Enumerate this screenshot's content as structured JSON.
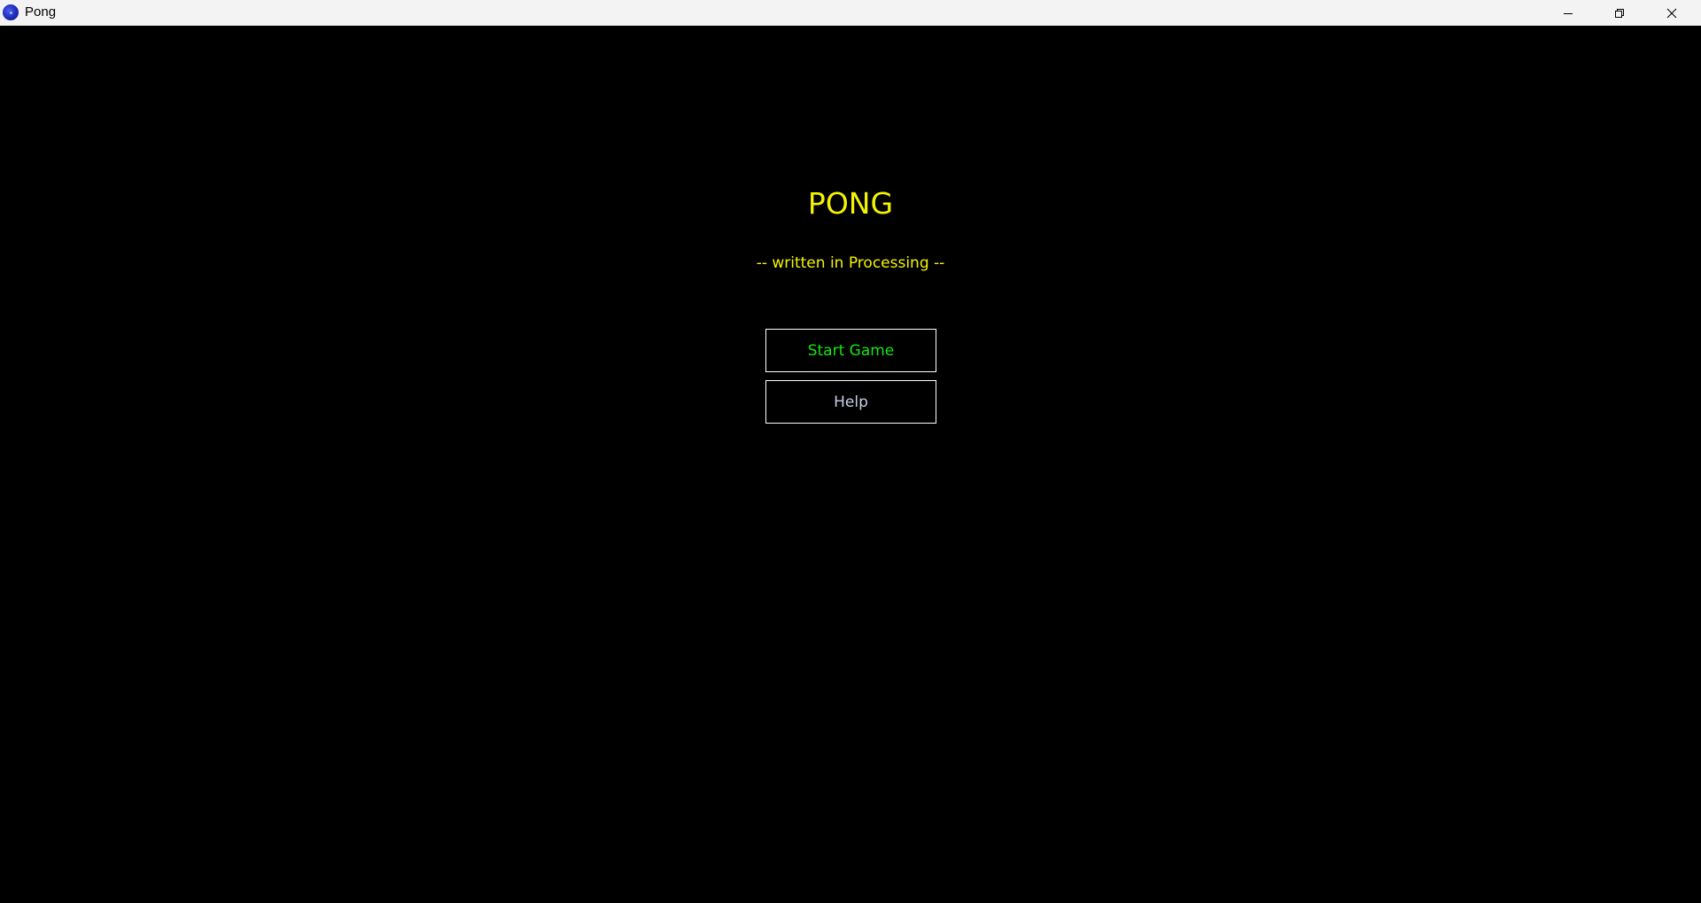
{
  "window": {
    "title": "Pong",
    "icon": "pong-app-icon",
    "controls": {
      "minimize_icon": "minimize-icon",
      "maximize_icon": "restore-icon",
      "close_icon": "close-icon"
    }
  },
  "menu": {
    "title": "PONG",
    "subtitle": "-- written in Processing --",
    "start_label": "Start Game",
    "help_label": "Help"
  },
  "colors": {
    "background": "#000000",
    "title_text": "#f4f400",
    "start_text": "#14e614",
    "help_text": "#c8cfe6",
    "button_border": "#ffffff",
    "titlebar": "#f3f3f3"
  }
}
